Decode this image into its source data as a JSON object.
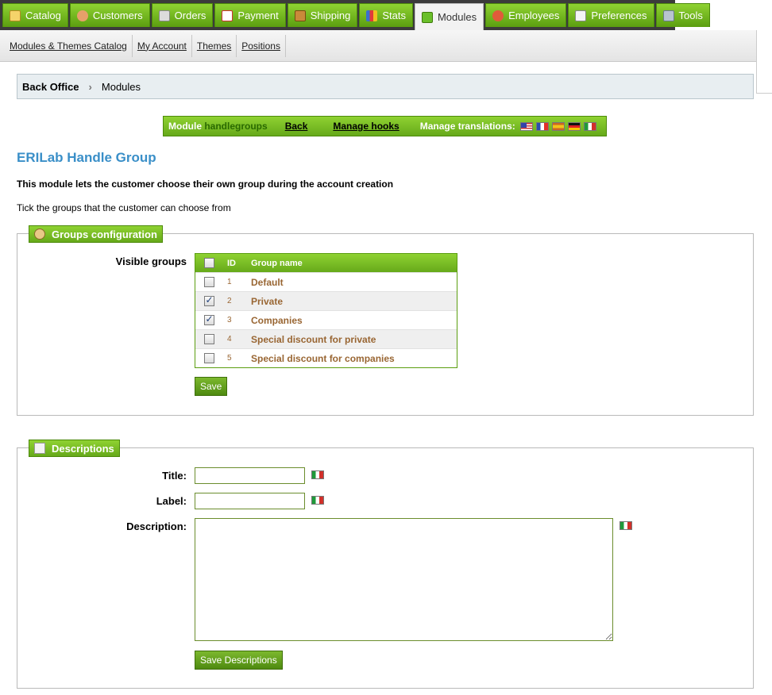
{
  "top_tabs": [
    {
      "label": "Catalog",
      "icon": "folder-icon"
    },
    {
      "label": "Customers",
      "icon": "customer-icon"
    },
    {
      "label": "Orders",
      "icon": "cart-icon"
    },
    {
      "label": "Payment",
      "icon": "payment-icon"
    },
    {
      "label": "Shipping",
      "icon": "truck-icon"
    },
    {
      "label": "Stats",
      "icon": "chart-icon"
    },
    {
      "label": "Modules",
      "icon": "puzzle-icon",
      "active": true
    },
    {
      "label": "Employees",
      "icon": "employee-icon"
    },
    {
      "label": "Preferences",
      "icon": "preferences-icon"
    },
    {
      "label": "Tools",
      "icon": "wrench-icon"
    }
  ],
  "submenu": {
    "catalog": "Modules & Themes Catalog",
    "account": "My Account",
    "themes": "Themes",
    "positions": "Positions"
  },
  "breadcrumb": {
    "root": "Back Office",
    "current": "Modules"
  },
  "module_bar": {
    "prefix": "Module",
    "name": "handlegroups",
    "back": "Back",
    "hooks": "Manage hooks",
    "translations": "Manage translations:"
  },
  "module": {
    "title": "ERILab Handle Group",
    "description": "This module lets the customer choose their own group during the account creation",
    "tick_info": "Tick the groups that the customer can choose from"
  },
  "groups_config": {
    "legend": "Groups configuration",
    "visible_label": "Visible groups",
    "col_id": "ID",
    "col_name": "Group name",
    "rows": [
      {
        "id": "1",
        "name": "Default",
        "checked": false
      },
      {
        "id": "2",
        "name": "Private",
        "checked": true
      },
      {
        "id": "3",
        "name": "Companies",
        "checked": true
      },
      {
        "id": "4",
        "name": "Special discount for private",
        "checked": false
      },
      {
        "id": "5",
        "name": "Special discount for companies",
        "checked": false
      }
    ],
    "save": "Save"
  },
  "descriptions": {
    "legend": "Descriptions",
    "title_label": "Title:",
    "label_label": "Label:",
    "description_label": "Description:",
    "title_value": "",
    "label_value": "",
    "description_value": "",
    "save": "Save Descriptions"
  },
  "colors": {
    "accent_green": "#66a91a",
    "title_blue": "#3a8fc8",
    "group_name_brown": "#996633"
  }
}
